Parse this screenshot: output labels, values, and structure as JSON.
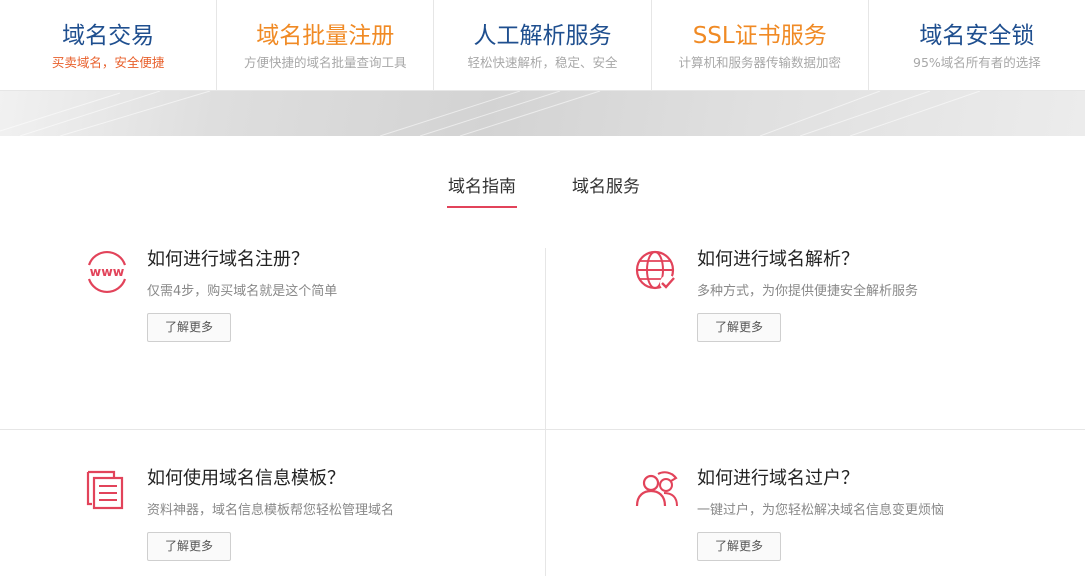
{
  "top_nav": [
    {
      "title": "域名交易",
      "subtitle": "买卖域名，安全便捷",
      "title_color": "#1f4f8f",
      "subtitle_color": "#e8602c"
    },
    {
      "title": "域名批量注册",
      "subtitle": "方便快捷的域名批量查询工具",
      "title_color": "#f08a24",
      "subtitle_color": "#a8a8a8"
    },
    {
      "title": "人工解析服务",
      "subtitle": "轻松快速解析，稳定、安全",
      "title_color": "#1f4f8f",
      "subtitle_color": "#a8a8a8"
    },
    {
      "title": "SSL证书服务",
      "subtitle": "计算机和服务器传输数据加密",
      "title_color": "#f08a24",
      "subtitle_color": "#a8a8a8"
    },
    {
      "title": "域名安全锁",
      "subtitle": "95%域名所有者的选择",
      "title_color": "#1f4f8f",
      "subtitle_color": "#a8a8a8"
    }
  ],
  "tabs": [
    {
      "label": "域名指南",
      "active": true
    },
    {
      "label": "域名服务",
      "active": false
    }
  ],
  "accent_color": "#e2435a",
  "guides": [
    {
      "icon": "www-icon",
      "title": "如何进行域名注册？",
      "desc": "仅需4步，购买域名就是这个简单",
      "button": "了解更多"
    },
    {
      "icon": "globe-check-icon",
      "title": "如何进行域名解析？",
      "desc": "多种方式，为你提供便捷安全解析服务",
      "button": "了解更多"
    },
    {
      "icon": "document-template-icon",
      "title": "如何使用域名信息模板？",
      "desc": "资料神器，域名信息模板帮您轻松管理域名",
      "button": "了解更多"
    },
    {
      "icon": "users-transfer-icon",
      "title": "如何进行域名过户？",
      "desc": "一键过户，为您轻松解决域名信息变更烦恼",
      "button": "了解更多"
    }
  ]
}
